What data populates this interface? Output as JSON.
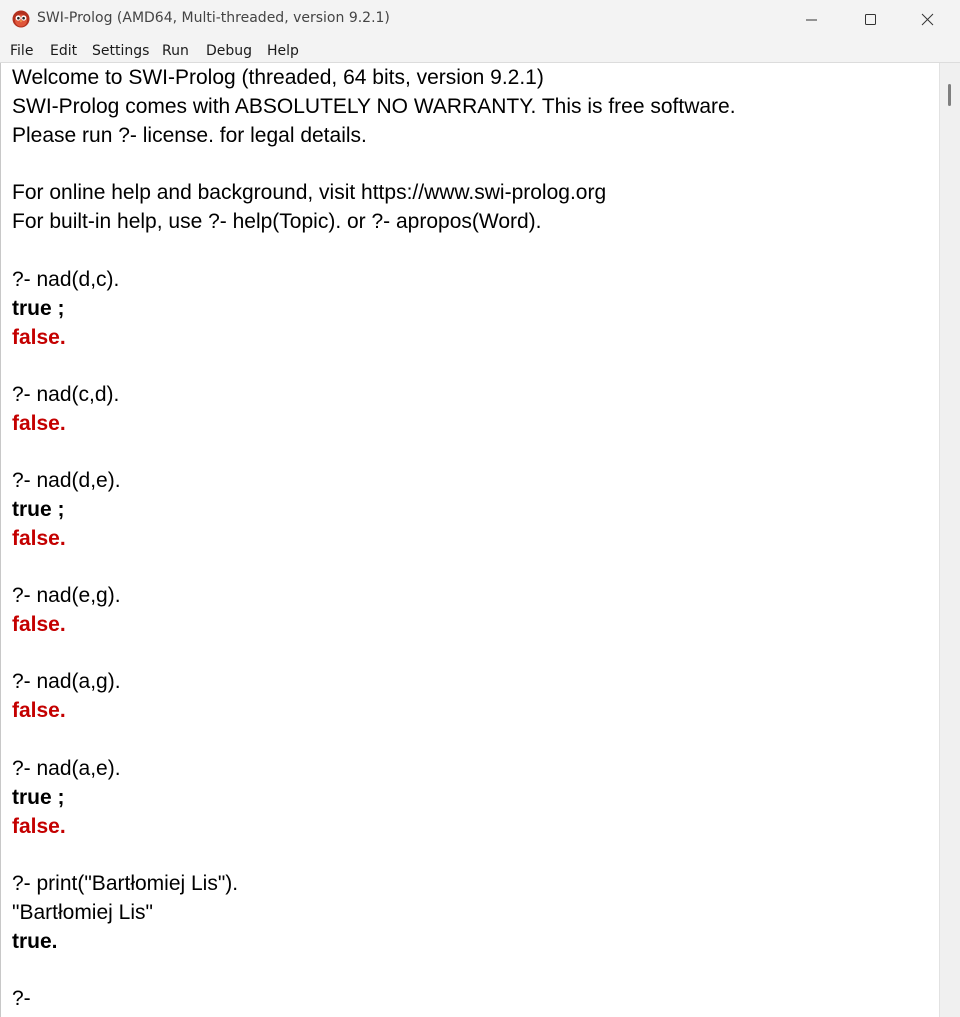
{
  "window": {
    "title": "SWI-Prolog (AMD64, Multi-threaded, version 9.2.1)",
    "icon": "swi-prolog-owl-icon",
    "controls": {
      "minimize": "minimize-icon",
      "maximize": "maximize-icon",
      "close": "close-icon"
    }
  },
  "menu": [
    "File",
    "Edit",
    "Settings",
    "Run",
    "Debug",
    "Help"
  ],
  "colors": {
    "false_text": "#c40000",
    "titlebar_bg": "#f3f3f3"
  },
  "console": {
    "banner": [
      "Welcome to SWI-Prolog (threaded, 64 bits, version 9.2.1)",
      "SWI-Prolog comes with ABSOLUTELY NO WARRANTY. This is free software.",
      "Please run ?- license. for legal details.",
      "For online help and background, visit https://www.swi-prolog.org",
      "For built-in help, use ?- help(Topic). or ?- apropos(Word)."
    ],
    "queries": [
      {
        "query": "?- nad(d,c).",
        "true": "true ;",
        "false": "false."
      },
      {
        "query": "?- nad(c,d).",
        "false": "false."
      },
      {
        "query": "?- nad(d,e).",
        "true": "true ;",
        "false": "false."
      },
      {
        "query": "?- nad(e,g).",
        "false": "false."
      },
      {
        "query": "?- nad(a,g).",
        "false": "false."
      },
      {
        "query": "?- nad(a,e).",
        "true": "true ;",
        "false": "false."
      },
      {
        "query": "?- print(\"Bartłomiej Lis\").",
        "output": "\"Bartłomiej Lis\"",
        "true": "true."
      }
    ],
    "prompt": "?-"
  }
}
